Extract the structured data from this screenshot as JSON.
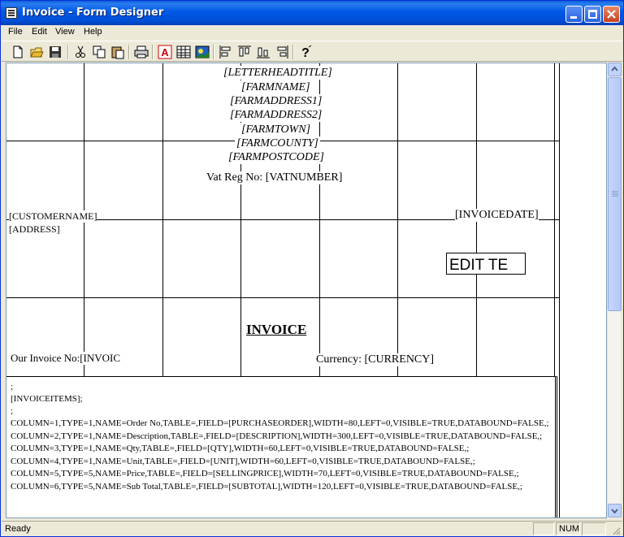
{
  "window": {
    "title": "Invoice - Form Designer"
  },
  "menu": {
    "items": [
      "File",
      "Edit",
      "View",
      "Help"
    ]
  },
  "toolbar": {
    "icons": [
      "new-icon",
      "open-icon",
      "save-icon",
      "cut-icon",
      "copy-icon",
      "paste-icon",
      "print-icon",
      "text-field-icon",
      "table-icon",
      "image-icon",
      "align-left-icon",
      "align-top-icon",
      "align-bottom-icon",
      "align-right-icon",
      "help-icon"
    ]
  },
  "form": {
    "header": {
      "letterhead": "[LETTERHEADTITLE]",
      "farmname": "[FARMNAME]",
      "address1": "[FARMADDRESS1]",
      "address2": "[FARMADDRESS2]",
      "town": "[FARMTOWN]",
      "county": "[FARMCOUNTY]",
      "postcode": "[FARMPOSTCODE]",
      "vat": "Vat Reg No: [VATNUMBER]"
    },
    "customer_name": "[CUSTOMERNAME]",
    "address": "[ADDRESS]",
    "invoice_date": "[INVOICEDATE]",
    "edit_box": "EDIT TE",
    "invoice_title": "INVOICE",
    "our_invoice_no": "Our Invoice No:[INVOIC",
    "currency": "Currency: [CURRENCY]",
    "items_block": {
      "lines": [
        ";",
        "[INVOICEITEMS];",
        ";",
        "COLUMN=1,TYPE=1,NAME=Order No,TABLE=,FIELD=[PURCHASEORDER],WIDTH=80,LEFT=0,VISIBLE=TRUE,DATABOUND=FALSE,;",
        "COLUMN=2,TYPE=1,NAME=Description,TABLE=,FIELD=[DESCRIPTION],WIDTH=300,LEFT=0,VISIBLE=TRUE,DATABOUND=FALSE,;",
        "COLUMN=3,TYPE=1,NAME=Qty,TABLE=,FIELD=[QTY],WIDTH=60,LEFT=0,VISIBLE=TRUE,DATABOUND=FALSE,;",
        "COLUMN=4,TYPE=1,NAME=Unit,TABLE=,FIELD=[UNIT],WIDTH=60,LEFT=0,VISIBLE=TRUE,DATABOUND=FALSE,;",
        "COLUMN=5,TYPE=5,NAME=Price,TABLE=,FIELD=[SELLINGPRICE],WIDTH=70,LEFT=0,VISIBLE=TRUE,DATABOUND=FALSE,;",
        "COLUMN=6,TYPE=5,NAME=Sub Total,TABLE=,FIELD=[SUBTOTAL],WIDTH=120,LEFT=0,VISIBLE=TRUE,DATABOUND=FALSE,;"
      ]
    }
  },
  "statusbar": {
    "text": "Ready",
    "num": "NUM"
  }
}
